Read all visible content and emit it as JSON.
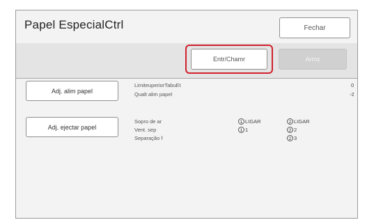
{
  "window": {
    "title": "Papel EspecialCtrl",
    "close_label": "Fechar"
  },
  "toolbar": {
    "enter_label": "Entr/Chamr",
    "store_label": "Armz"
  },
  "paper_adjust": {
    "button_label": "Adj. alim papel",
    "rows": [
      {
        "label": "LimiteuperiorTabuEt",
        "value": "0"
      },
      {
        "label": "Qualt alim papel",
        "value": "-2"
      }
    ]
  },
  "eject_adjust": {
    "button_label": "Adj. ejectar papel",
    "labels": [
      "Sopro de ar",
      "Vent. sep",
      "Separação f"
    ],
    "col1": [
      {
        "num": "1",
        "text": "LIGAR"
      },
      {
        "num": "1",
        "text": "1"
      }
    ],
    "col2": [
      {
        "num": "2",
        "text": "LIGAR"
      },
      {
        "num": "2",
        "text": "2"
      },
      {
        "num": "2",
        "text": "3"
      }
    ]
  },
  "highlight_color": "#d0202c"
}
